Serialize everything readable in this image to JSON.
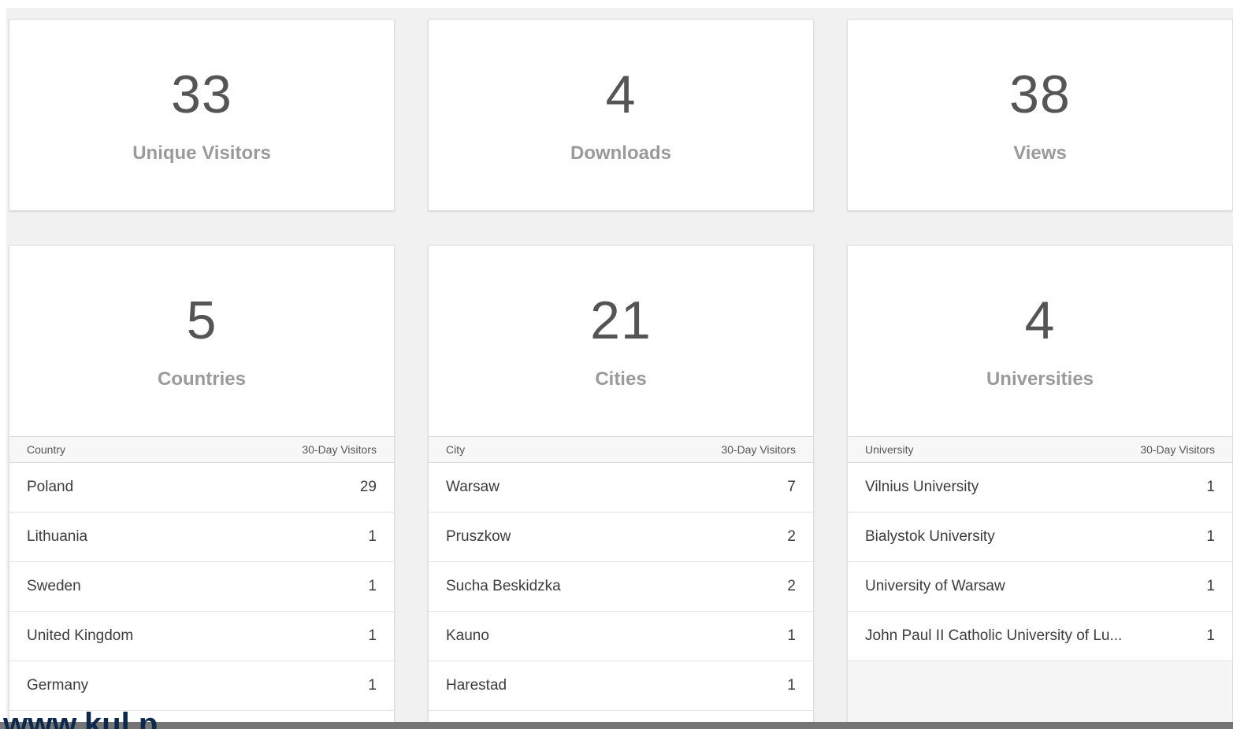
{
  "stats": {
    "unique_visitors": {
      "value": "33",
      "label": "Unique Visitors"
    },
    "downloads": {
      "value": "4",
      "label": "Downloads"
    },
    "views": {
      "value": "38",
      "label": "Views"
    },
    "countries": {
      "value": "5",
      "label": "Countries"
    },
    "cities": {
      "value": "21",
      "label": "Cities"
    },
    "universities": {
      "value": "4",
      "label": "Universities"
    }
  },
  "countries_table": {
    "col_name": "Country",
    "col_visitors": "30-Day Visitors",
    "rows": [
      {
        "name": "Poland",
        "visitors": "29"
      },
      {
        "name": "Lithuania",
        "visitors": "1"
      },
      {
        "name": "Sweden",
        "visitors": "1"
      },
      {
        "name": "United Kingdom",
        "visitors": "1"
      },
      {
        "name": "Germany",
        "visitors": "1"
      }
    ]
  },
  "cities_table": {
    "col_name": "City",
    "col_visitors": "30-Day Visitors",
    "rows": [
      {
        "name": "Warsaw",
        "visitors": "7"
      },
      {
        "name": "Pruszkow",
        "visitors": "2"
      },
      {
        "name": "Sucha Beskidzka",
        "visitors": "2"
      },
      {
        "name": "Kauno",
        "visitors": "1"
      },
      {
        "name": "Harestad",
        "visitors": "1"
      }
    ]
  },
  "universities_table": {
    "col_name": "University",
    "col_visitors": "30-Day Visitors",
    "rows": [
      {
        "name": "Vilnius University",
        "visitors": "1"
      },
      {
        "name": "Bialystok University",
        "visitors": "1"
      },
      {
        "name": "University of Warsaw",
        "visitors": "1"
      },
      {
        "name": "John Paul II Catholic University of Lu...",
        "visitors": "1"
      }
    ]
  },
  "watermark": "www.kul.p",
  "colors": {
    "panel_bg": "#f1f1f1",
    "number": "#555555",
    "label": "#9a9a9a",
    "watermark": "#0c2a4d"
  }
}
